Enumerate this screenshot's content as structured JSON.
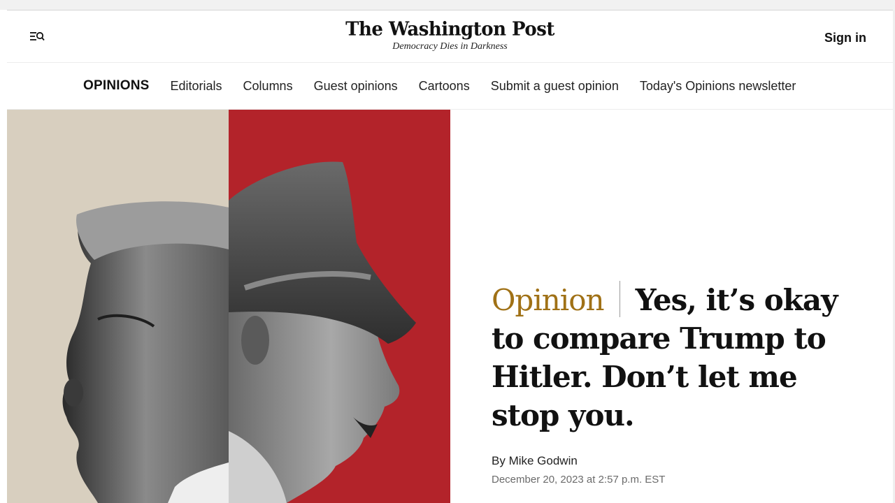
{
  "masthead": {
    "logo": "The Washington Post",
    "tagline": "Democracy Dies in Darkness",
    "sign_in": "Sign in",
    "menu_icon": "menu-search-icon"
  },
  "subnav": {
    "section": "OPINIONS",
    "items": [
      "Editorials",
      "Columns",
      "Guest opinions",
      "Cartoons",
      "Submit a guest opinion",
      "Today's Opinions newsletter"
    ]
  },
  "article": {
    "kicker": "Opinion",
    "title": "Yes, it’s okay to compare Trump to Hitler. Don’t let me stop you.",
    "byline_prefix": "By ",
    "author": "Mike Godwin",
    "date": "December 20, 2023 at 2:57 p.m. EST"
  },
  "colors": {
    "kicker": "#a07116",
    "hero_left_bg": "#d8cfbf",
    "hero_right_bg": "#b3232a"
  }
}
